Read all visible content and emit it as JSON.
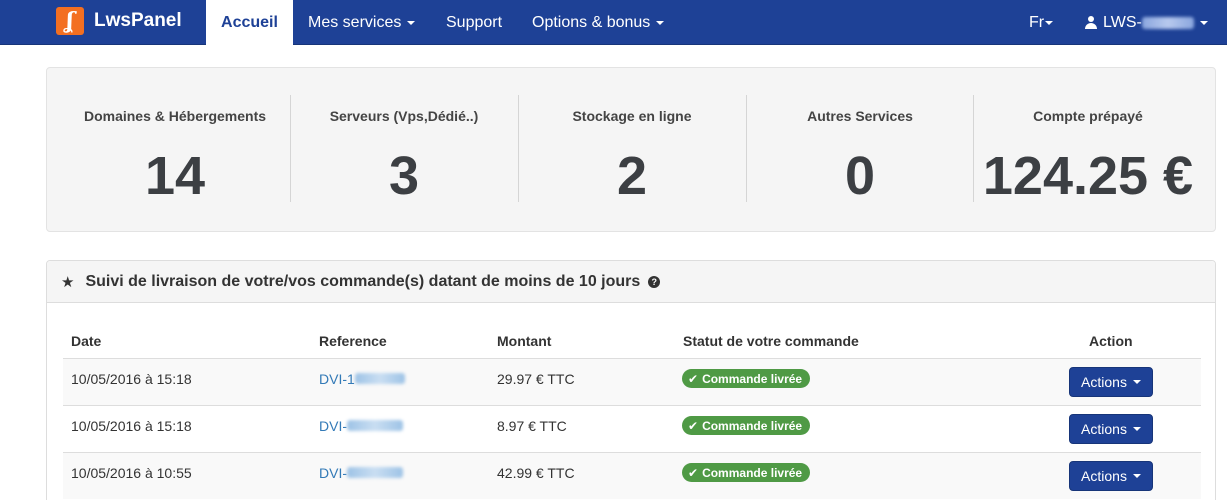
{
  "navbar": {
    "brand_name": "LwsPanel",
    "brand_logo_glyph": "ʆ",
    "items": [
      {
        "label": "Accueil",
        "active": true
      },
      {
        "label": "Mes services",
        "dropdown": true
      },
      {
        "label": "Support"
      },
      {
        "label": "Options & bonus",
        "dropdown": true
      }
    ],
    "language": "Fr",
    "user_prefix": "LWS-"
  },
  "stats": [
    {
      "label": "Domaines & Hébergements",
      "value": "14"
    },
    {
      "label": "Serveurs (Vps,Dédié..)",
      "value": "3"
    },
    {
      "label": "Stockage en ligne",
      "value": "2"
    },
    {
      "label": "Autres Services",
      "value": "0"
    },
    {
      "label": "Compte prépayé",
      "value": "124.25 €"
    }
  ],
  "orders": {
    "title": "Suivi de livraison de votre/vos commande(s) datant de moins de 10 jours",
    "columns": [
      "Date",
      "Reference",
      "Montant",
      "Statut de votre commande",
      "Action"
    ],
    "rows": [
      {
        "date": "10/05/2016 à 15:18",
        "reference": "DVI-1",
        "amount": "29.97 € TTC",
        "status": "Commande livrée",
        "action": "Actions"
      },
      {
        "date": "10/05/2016 à 15:18",
        "reference": "DVI-",
        "amount": "8.97 € TTC",
        "status": "Commande livrée",
        "action": "Actions"
      },
      {
        "date": "10/05/2016 à 10:55",
        "reference": "DVI-",
        "amount": "42.99 € TTC",
        "status": "Commande livrée",
        "action": "Actions"
      }
    ]
  },
  "colors": {
    "navbar": "#1e4196",
    "brand_logo": "#f36f21",
    "status_badge": "#4f9a45",
    "link": "#337ab7"
  }
}
